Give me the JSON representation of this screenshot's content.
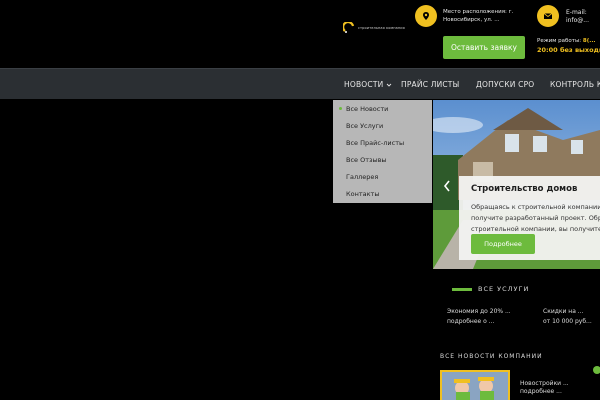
{
  "header": {
    "logo_text": "строительная компания",
    "address": "Место расположения: г. Новосибирск, ул. ...",
    "email": "E-mail: info@...",
    "cta_label": "Оставить заявку",
    "hours_label": "Режим работы:",
    "phone": "8(...",
    "hours": "20:00 без выходных"
  },
  "nav": {
    "items": [
      {
        "label": "НОВОСТИ"
      },
      {
        "label": "ПРАЙС ЛИСТЫ"
      },
      {
        "label": "ДОПУСКИ СРО"
      },
      {
        "label": "КОНТРОЛЬ КА"
      }
    ]
  },
  "dropdown": {
    "items": [
      {
        "label": "Все Новости"
      },
      {
        "label": "Все Услуги"
      },
      {
        "label": "Все Прайс-листы"
      },
      {
        "label": "Все Отзывы"
      },
      {
        "label": "Галлерея"
      },
      {
        "label": "Контакты"
      }
    ]
  },
  "slider": {
    "title": "Строительство домов",
    "text_line1": "Обращаясь к строительной компании, в",
    "text_line2": "получите разработанный проект. Обращ",
    "text_line3": "строительной компании, вы получите",
    "button_label": "Подробнее"
  },
  "tabs": {
    "label": "ВСЕ УСЛУГИ"
  },
  "promo": {
    "left_line1": "Экономия до 20% ...",
    "left_line2": "подробнее о ...",
    "right_line1": "Скидки на ...",
    "right_line2": "от 10 000 руб..."
  },
  "news": {
    "heading": "ВСЕ НОВОСТИ КОМПАНИИ",
    "text_line1": "Новостройки ...",
    "text_line2": "подробнее ..."
  },
  "colors": {
    "accent_green": "#6dbb3d",
    "accent_yellow": "#f0c020",
    "nav_bg": "#2b2f33",
    "dropdown_bg": "#b7b7b7"
  },
  "icons": {
    "address": "location-pin-icon",
    "email": "envelope-icon",
    "dropdown_chevron": "chevron-down-icon",
    "slider_prev": "chevron-left-icon"
  }
}
